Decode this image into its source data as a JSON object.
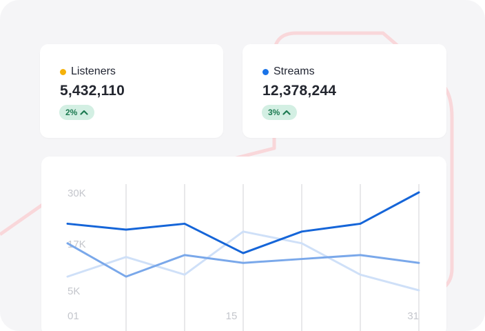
{
  "stats": [
    {
      "label": "Listeners",
      "value": "5,432,110",
      "change": "2%",
      "dot_color": "#f5b20b"
    },
    {
      "label": "Streams",
      "value": "12,378,244",
      "change": "3%",
      "dot_color": "#1a73e8"
    }
  ],
  "colors": {
    "badge_bg": "#d3efe3",
    "badge_text": "#1c7a51",
    "series_dark": "#1565d8",
    "series_mid": "#7aa8ea",
    "series_light": "#cfe0f8",
    "grid": "#d8d8dc",
    "decoration": "#f9d7da"
  },
  "chart_data": {
    "type": "line",
    "y_ticks": [
      "30K",
      "17K",
      "5K"
    ],
    "y_tick_values": [
      30000,
      17000,
      5000
    ],
    "x_ticks": [
      "01",
      "15",
      "31"
    ],
    "x_tick_values": [
      1,
      15,
      31
    ],
    "x": [
      1,
      6,
      11,
      16,
      21,
      26,
      31
    ],
    "series": [
      {
        "values": [
          22000,
          20500,
          22000,
          14500,
          20000,
          22000,
          30000
        ]
      },
      {
        "values": [
          17000,
          8500,
          14000,
          12000,
          13000,
          14000,
          12000
        ]
      },
      {
        "values": [
          8500,
          13500,
          9000,
          20000,
          17000,
          9000,
          5000
        ]
      }
    ]
  }
}
